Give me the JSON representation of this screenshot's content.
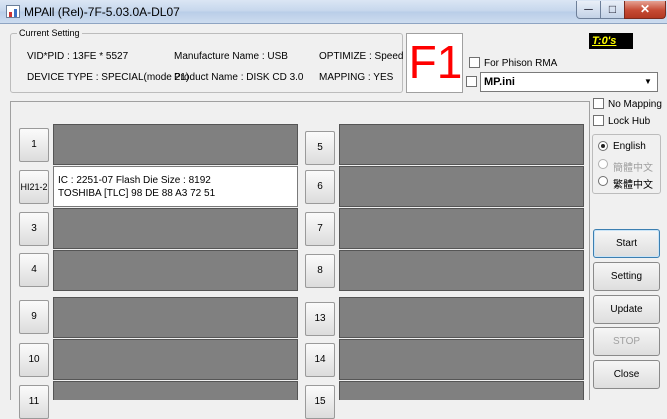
{
  "window": {
    "title": "MPAll (Rel)-7F-5.03.0A-DL07",
    "min_glyph": "─",
    "max_glyph": "□",
    "close_glyph": "✕"
  },
  "current_setting": {
    "legend": "Current Setting",
    "vid_pid": "VID*PID : 13FE * 5527",
    "manufacture": "Manufacture Name : USB",
    "optimize": "OPTIMIZE : Speed",
    "device_type": "DEVICE TYPE : SPECIAL(mode 21)",
    "product": "Product Name : DISK CD 3.0",
    "mapping": "MAPPING : YES"
  },
  "f1_label": "F1",
  "timer": "T:0's",
  "options": {
    "for_phison_rma": "For Phison RMA",
    "ini_file": "MP.ini",
    "no_mapping": "No Mapping",
    "lock_hub": "Lock Hub"
  },
  "language": {
    "english": "English",
    "simplified": "簡體中文",
    "traditional": "繁體中文",
    "selected": "english"
  },
  "ports": {
    "left": [
      {
        "label": "1"
      },
      {
        "label": "HI21-2",
        "line1": "IC : 2251-07  Flash Die Size : 8192",
        "line2": "TOSHIBA [TLC] 98 DE 88 A3 72 51"
      },
      {
        "label": "3"
      },
      {
        "label": "4"
      },
      {
        "label": "9"
      },
      {
        "label": "10"
      },
      {
        "label": "11"
      }
    ],
    "right": [
      {
        "label": "5"
      },
      {
        "label": "6"
      },
      {
        "label": "7"
      },
      {
        "label": "8"
      },
      {
        "label": "13"
      },
      {
        "label": "14"
      },
      {
        "label": "15"
      }
    ]
  },
  "actions": {
    "start": "Start",
    "setting": "Setting",
    "update": "Update",
    "stop": "STOP",
    "close": "Close"
  }
}
